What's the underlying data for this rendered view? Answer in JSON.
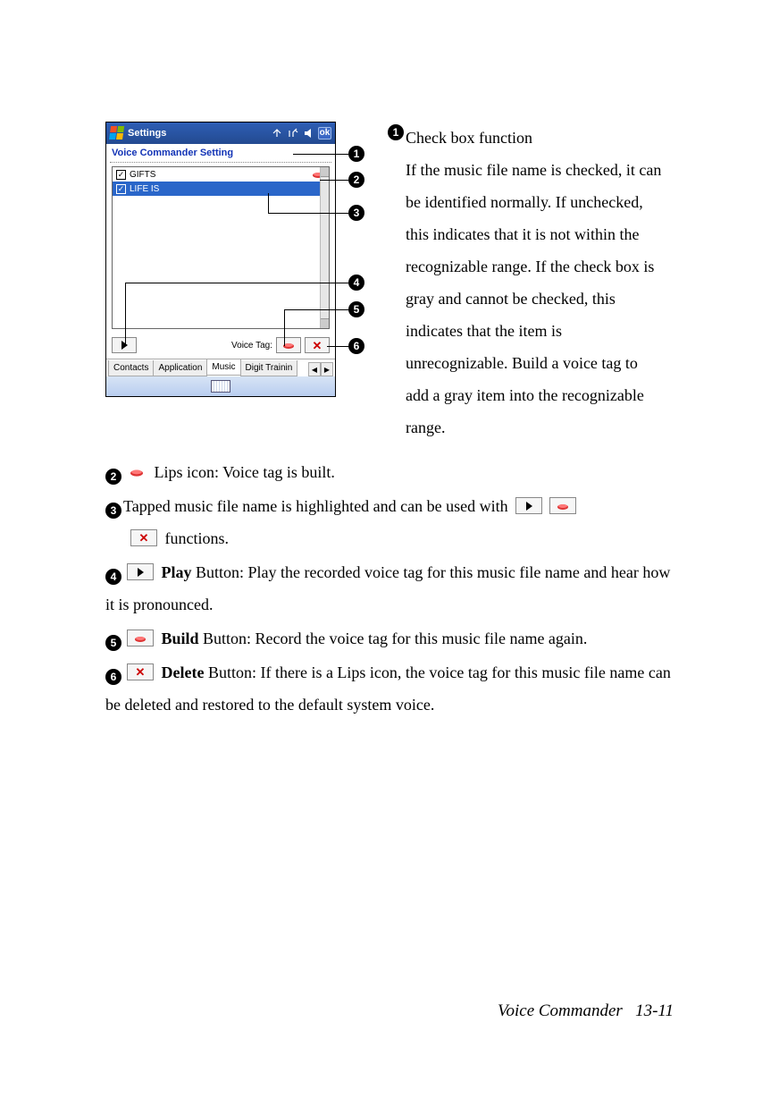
{
  "device": {
    "titlebar_label": "Settings",
    "ok_label": "ok",
    "subtitle": "Voice Commander Setting",
    "list": {
      "item1": {
        "label": "GIFTS"
      },
      "item2": {
        "label": "LIFE IS"
      }
    },
    "voice_tag_label": "Voice Tag:",
    "tabs": {
      "t1": "Contacts",
      "t2": "Application",
      "t3": "Music",
      "t4": "Digit Trainin"
    }
  },
  "callouts": {
    "n1": "1",
    "n2": "2",
    "n3": "3",
    "n4": "4",
    "n5": "5",
    "n6": "6"
  },
  "desc1": {
    "title": "Check box function",
    "body": "If the music file name is checked, it can be identified normally. If unchecked, this indicates that it is not within the recognizable range. If the check box is gray and cannot be checked, this indicates that the item is unrecognizable. Build a voice tag to add a gray item into the recognizable range."
  },
  "desc2": {
    "text": " Lips icon: Voice tag is built."
  },
  "desc3": {
    "pre": "Tapped music file name is highlighted and can be used with ",
    "post": " functions."
  },
  "desc4": {
    "label_bold": "Play",
    "text": " Button: Play the recorded voice tag for this music file name and hear how it is pronounced."
  },
  "desc5": {
    "label_bold": "Build",
    "text": " Button: Record the voice tag for this music file name again."
  },
  "desc6": {
    "label_bold": "Delete",
    "text": " Button: If there is a Lips icon, the voice tag for this music file name can be deleted and restored to the default system voice."
  },
  "footer": {
    "title": "Voice Commander",
    "page": "13-11"
  }
}
